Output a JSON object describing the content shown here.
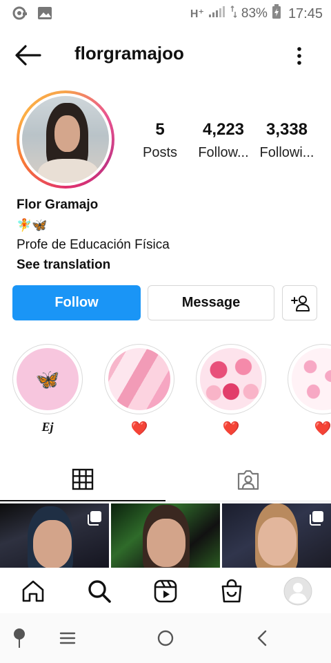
{
  "status_bar": {
    "network": "H⁺",
    "battery_percent": "83%",
    "time": "17:45"
  },
  "header": {
    "username": "florgramajoo"
  },
  "profile": {
    "stats": [
      {
        "value": "5",
        "label": "Posts"
      },
      {
        "value": "4,223",
        "label": "Follow..."
      },
      {
        "value": "3,338",
        "label": "Followi..."
      }
    ],
    "name": "Flor Gramajo",
    "emoji_line": "🧚🦋",
    "bio": "Profe de Educación Física",
    "see_translation": "See translation"
  },
  "actions": {
    "follow": "Follow",
    "message": "Message"
  },
  "highlights": [
    {
      "label": "Ej",
      "icon": "🦋"
    },
    {
      "label": "❤️"
    },
    {
      "label": "❤️"
    },
    {
      "label": "❤️"
    }
  ],
  "colors": {
    "accent": "#1a95f6",
    "heart": "#e0203f"
  }
}
